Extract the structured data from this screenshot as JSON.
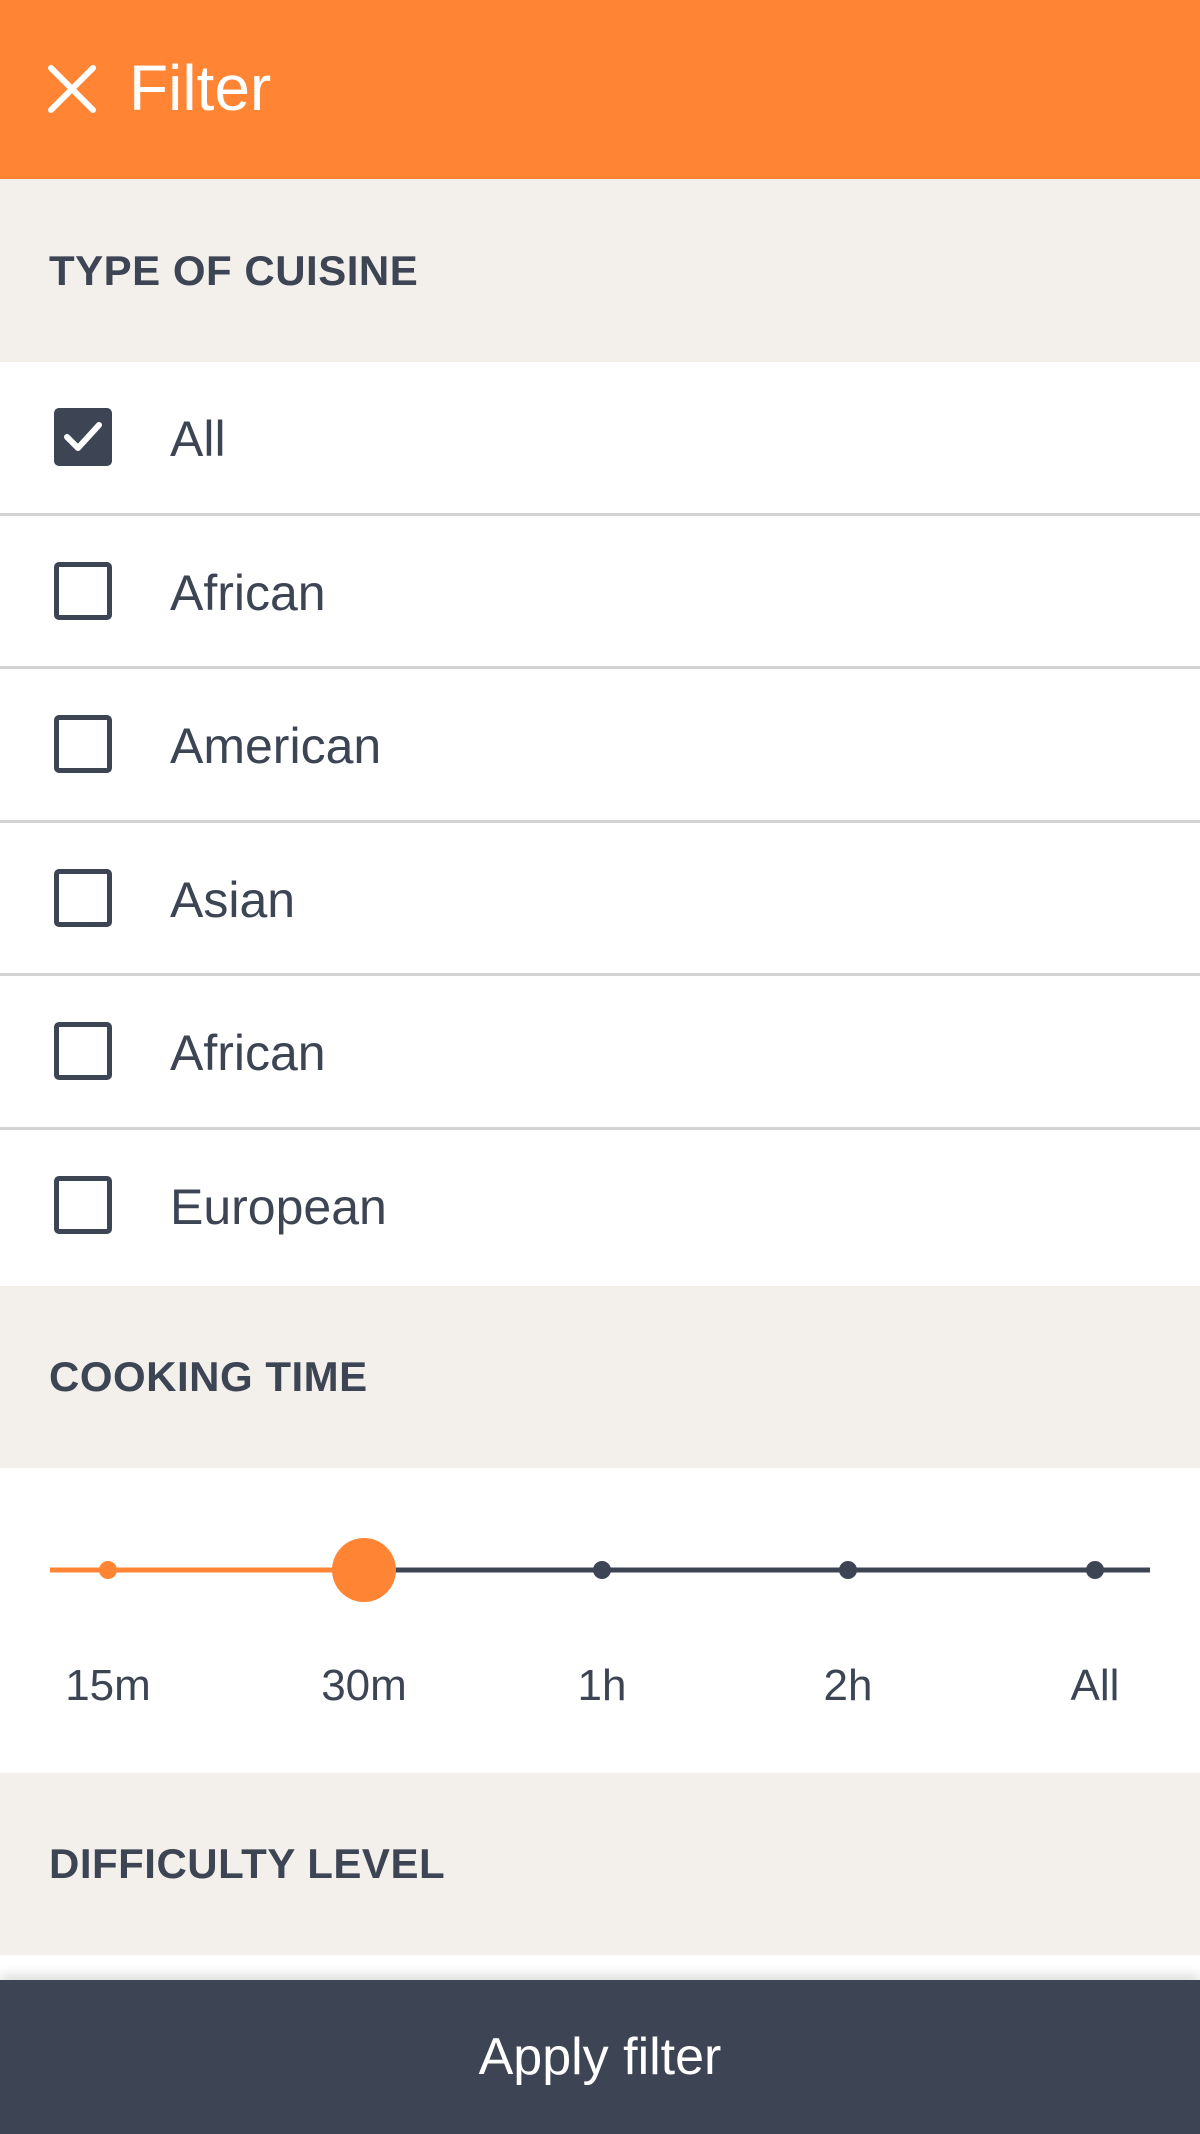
{
  "header": {
    "title": "Filter",
    "close_icon": "close-icon",
    "background_color": "#ff8534"
  },
  "cuisine_section": {
    "title": "TYPE OF CUISINE",
    "options": [
      {
        "label": "All",
        "checked": true
      },
      {
        "label": "African",
        "checked": false
      },
      {
        "label": "American",
        "checked": false
      },
      {
        "label": "Asian",
        "checked": false
      },
      {
        "label": "African",
        "checked": false
      },
      {
        "label": "European",
        "checked": false
      }
    ]
  },
  "cooking_time_section": {
    "title": "COOKING TIME",
    "ticks": [
      "15m",
      "30m",
      "1h",
      "2h",
      "All"
    ],
    "selected": "30m",
    "accent_color": "#ff8534",
    "track_color": "#3d4555"
  },
  "difficulty_section": {
    "title": "DIFFICULTY LEVEL"
  },
  "apply_button": {
    "label": "Apply filter"
  }
}
